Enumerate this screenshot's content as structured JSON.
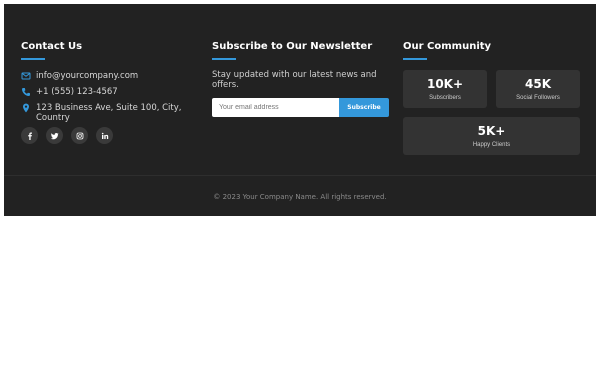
{
  "contact": {
    "heading": "Contact Us",
    "email": "info@yourcompany.com",
    "phone": "+1 (555) 123-4567",
    "address": "123 Business Ave, Suite 100, City, Country",
    "icons": [
      "envelope-icon",
      "phone-icon",
      "map-pin-icon"
    ],
    "socials": [
      "facebook-icon",
      "twitter-icon",
      "instagram-icon",
      "linkedin-icon"
    ]
  },
  "newsletter": {
    "heading": "Subscribe to Our Newsletter",
    "text": "Stay updated with our latest news and offers.",
    "placeholder": "Your email address",
    "button_label": "Subscribe"
  },
  "community": {
    "heading": "Our Community",
    "stats": [
      {
        "value": "10K+",
        "label": "Subscribers"
      },
      {
        "value": "45K",
        "label": "Social Followers"
      },
      {
        "value": "5K+",
        "label": "Happy Clients"
      }
    ]
  },
  "copyright": "© 2023 Your Company Name. All rights reserved.",
  "colors": {
    "footer_bg": "#222222",
    "accent": "#3498db",
    "card_bg": "#333333",
    "page_bg": "#ffffff"
  }
}
